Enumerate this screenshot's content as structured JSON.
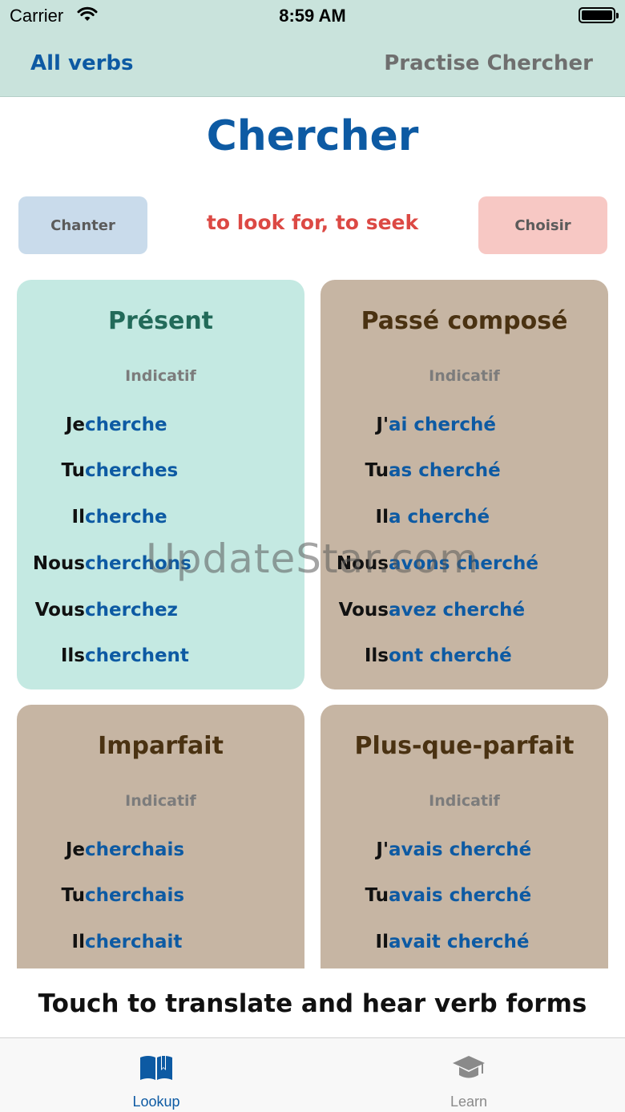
{
  "status_bar": {
    "carrier": "Carrier",
    "time": "8:59 AM"
  },
  "header": {
    "back_label": "All verbs",
    "practise_label": "Practise Chercher"
  },
  "verb": {
    "infinitive": "Chercher",
    "translation": "to look for, to seek",
    "previous": "Chanter",
    "next": "Choisir"
  },
  "tenses": [
    {
      "name": "Présent",
      "mood": "Indicatif",
      "rows": [
        {
          "pronoun": "Je",
          "form": "cherche"
        },
        {
          "pronoun": "Tu",
          "form": "cherches"
        },
        {
          "pronoun": "Il",
          "form": "cherche"
        },
        {
          "pronoun": "Nous",
          "form": "cherchons"
        },
        {
          "pronoun": "Vous",
          "form": "cherchez"
        },
        {
          "pronoun": "Ils",
          "form": "cherchent"
        }
      ]
    },
    {
      "name": "Passé composé",
      "mood": "Indicatif",
      "rows": [
        {
          "pronoun": "J'",
          "form": "ai cherché"
        },
        {
          "pronoun": "Tu",
          "form": "as cherché"
        },
        {
          "pronoun": "Il",
          "form": "a cherché"
        },
        {
          "pronoun": "Nous",
          "form": "avons cherché"
        },
        {
          "pronoun": "Vous",
          "form": "avez cherché"
        },
        {
          "pronoun": "Ils",
          "form": "ont cherché"
        }
      ]
    },
    {
      "name": "Imparfait",
      "mood": "Indicatif",
      "rows": [
        {
          "pronoun": "Je",
          "form": "cherchais"
        },
        {
          "pronoun": "Tu",
          "form": "cherchais"
        },
        {
          "pronoun": "Il",
          "form": "cherchait"
        }
      ]
    },
    {
      "name": "Plus-que-parfait",
      "mood": "Indicatif",
      "rows": [
        {
          "pronoun": "J'",
          "form": "avais cherché"
        },
        {
          "pronoun": "Tu",
          "form": "avais cherché"
        },
        {
          "pronoun": "Il",
          "form": "avait cherché"
        }
      ]
    }
  ],
  "watermark": "UpdateStar.com",
  "hint": "Touch to translate and hear verb forms",
  "tabbar": {
    "tabs": [
      {
        "label": "Lookup",
        "icon": "book-icon",
        "selected": true
      },
      {
        "label": "Learn",
        "icon": "graduation-cap-icon",
        "selected": false
      }
    ]
  },
  "colors": {
    "header_bg": "#c9e3dc",
    "accent_blue": "#0d5aa3",
    "translation_red": "#dc4944",
    "present_card": "#c4e9e2",
    "tense_card": "#c6b5a3",
    "prev_button": "#c9dbeb",
    "next_button": "#f7c8c4"
  }
}
